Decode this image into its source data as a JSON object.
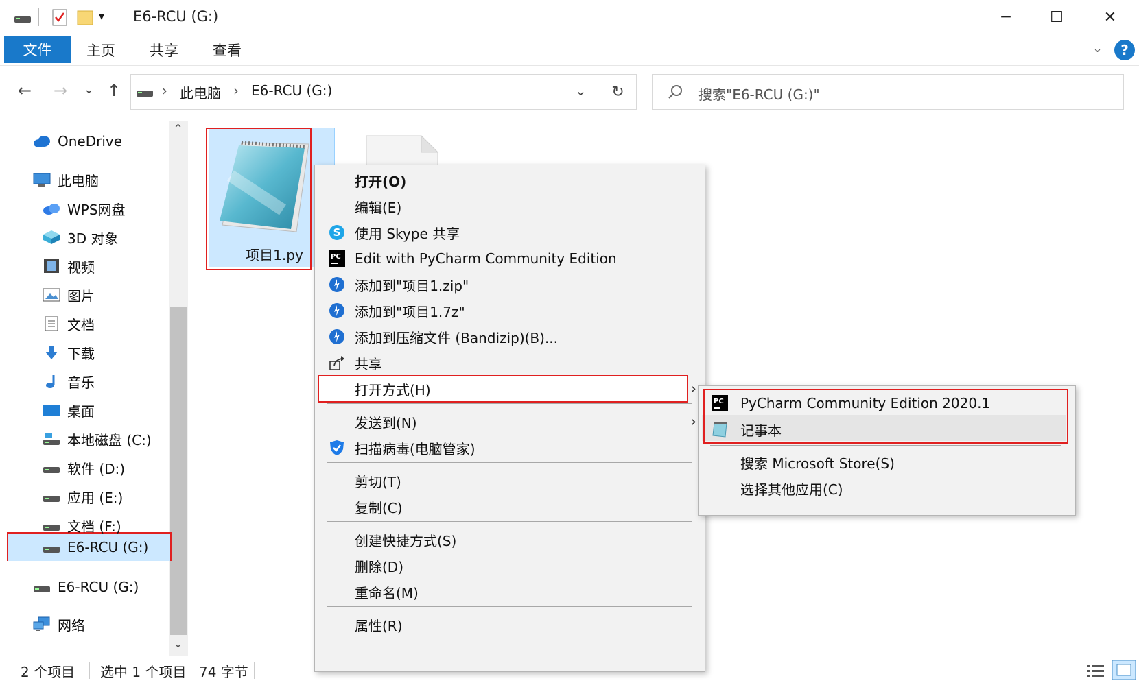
{
  "window": {
    "title": "E6-RCU (G:)",
    "minimize_glyph": "─",
    "maximize_glyph": "☐",
    "close_glyph": "✕"
  },
  "ribbon": {
    "file_tab": "文件",
    "tabs": [
      "主页",
      "共享",
      "查看"
    ],
    "help_glyph": "?"
  },
  "address": {
    "back_glyph": "←",
    "forward_glyph": "→",
    "recent_glyph": "⌄",
    "up_glyph": "↑",
    "crumbs": [
      "此电脑",
      "E6-RCU (G:)"
    ],
    "sep_glyph": "›",
    "dropdown_glyph": "⌄",
    "refresh_glyph": "↻"
  },
  "search": {
    "placeholder": "搜索\"E6-RCU (G:)\""
  },
  "sidebar": {
    "items": [
      {
        "label": "OneDrive",
        "icon": "cloud-icon"
      },
      {
        "label": "此电脑",
        "icon": "computer-icon"
      },
      {
        "label": "WPS网盘",
        "icon": "wps-cloud-icon"
      },
      {
        "label": "3D 对象",
        "icon": "cube-icon"
      },
      {
        "label": "视频",
        "icon": "video-icon"
      },
      {
        "label": "图片",
        "icon": "picture-icon"
      },
      {
        "label": "文档",
        "icon": "document-icon"
      },
      {
        "label": "下载",
        "icon": "download-icon"
      },
      {
        "label": "音乐",
        "icon": "music-icon"
      },
      {
        "label": "桌面",
        "icon": "desktop-icon"
      },
      {
        "label": "本地磁盘 (C:)",
        "icon": "system-drive-icon"
      },
      {
        "label": "软件 (D:)",
        "icon": "drive-icon"
      },
      {
        "label": "应用 (E:)",
        "icon": "drive-icon"
      },
      {
        "label": "文档 (F:)",
        "icon": "drive-icon"
      },
      {
        "label": "E6-RCU (G:)",
        "icon": "usb-drive-icon"
      },
      {
        "label": "E6-RCU (G:)",
        "icon": "usb-drive-icon"
      },
      {
        "label": "网络",
        "icon": "network-icon"
      }
    ],
    "scroll_up_glyph": "⌃",
    "scroll_down_glyph": "⌄"
  },
  "files": [
    {
      "name": "项目1.py",
      "icon": "notepad-icon",
      "selected": true
    },
    {
      "name": "",
      "icon": "blank-file-icon",
      "selected": false
    }
  ],
  "context_menu": {
    "items": [
      {
        "label": "打开(O)",
        "icon": "",
        "bold": true
      },
      {
        "label": "编辑(E)",
        "icon": ""
      },
      {
        "label": "使用 Skype 共享",
        "icon": "skype-icon"
      },
      {
        "label": "Edit with PyCharm Community Edition",
        "icon": "pycharm-icon"
      },
      {
        "label": "添加到\"项目1.zip\"",
        "icon": "bandizip-icon"
      },
      {
        "label": "添加到\"项目1.7z\"",
        "icon": "bandizip-icon"
      },
      {
        "label": "添加到压缩文件 (Bandizip)(B)...",
        "icon": "bandizip-icon"
      },
      {
        "label": "共享",
        "icon": "share-icon"
      },
      {
        "label": "打开方式(H)",
        "icon": "",
        "submenu": true
      },
      {
        "label": "发送到(N)",
        "icon": "",
        "submenu": true
      },
      {
        "label": "扫描病毒(电脑管家)",
        "icon": "shield-icon"
      },
      {
        "label": "剪切(T)",
        "icon": ""
      },
      {
        "label": "复制(C)",
        "icon": ""
      },
      {
        "label": "创建快捷方式(S)",
        "icon": ""
      },
      {
        "label": "删除(D)",
        "icon": ""
      },
      {
        "label": "重命名(M)",
        "icon": ""
      },
      {
        "label": "属性(R)",
        "icon": ""
      }
    ],
    "arrow_glyph": "›"
  },
  "open_with_submenu": {
    "items": [
      {
        "label": "PyCharm Community Edition 2020.1",
        "icon": "pycharm-icon"
      },
      {
        "label": "记事本",
        "icon": "notepad-icon"
      },
      {
        "label": "搜索 Microsoft Store(S)",
        "icon": ""
      },
      {
        "label": "选择其他应用(C)",
        "icon": ""
      }
    ]
  },
  "status": {
    "item_count": "2 个项目",
    "selected": "选中 1 个项目",
    "size": "74 字节"
  },
  "colors": {
    "accent": "#1979ca",
    "selection": "#cce8ff",
    "highlight_box": "#e02020",
    "menu_bg": "#f2f2f2"
  }
}
